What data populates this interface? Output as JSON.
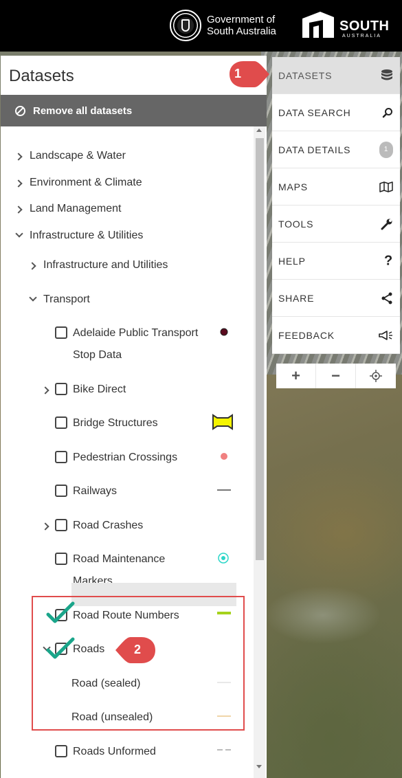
{
  "header": {
    "gov_line1": "Government of",
    "gov_line2": "South Australia",
    "brand": "SOUTH",
    "brand_sub": "AUSTRALIA"
  },
  "panel": {
    "title": "Datasets",
    "remove_all": "Remove all datasets"
  },
  "tree": {
    "categories": [
      "Landscape & Water",
      "Environment & Climate",
      "Land Management",
      "Infrastructure & Utilities"
    ],
    "sub": [
      "Infrastructure and Utilities",
      "Transport"
    ],
    "layers": {
      "adelaide_line1": "Adelaide Public Transport",
      "adelaide_line2": "Stop Data",
      "bike": "Bike Direct",
      "bridge": "Bridge Structures",
      "pedestrian": "Pedestrian Crossings",
      "railways": "Railways",
      "crashes": "Road Crashes",
      "maint_line1": "Road Maintenance",
      "maint_line2": "Markers",
      "route_numbers": "Road Route Numbers",
      "roads": "Roads",
      "sealed": "Road (sealed)",
      "unsealed": "Road (unsealed)",
      "unformed": "Roads Unformed"
    }
  },
  "callouts": {
    "one": "1",
    "two": "2"
  },
  "nav": {
    "items": [
      "DATASETS",
      "DATA SEARCH",
      "DATA DETAILS",
      "MAPS",
      "TOOLS",
      "HELP",
      "SHARE",
      "FEEDBACK"
    ],
    "details_badge": "1",
    "icons": [
      "database-icon",
      "search-icon",
      "badge",
      "map-icon",
      "wrench-icon",
      "question-icon",
      "share-icon",
      "megaphone-icon"
    ]
  },
  "zoom": {
    "in": "+",
    "out": "−"
  },
  "colors": {
    "active_nav": "#e0e0e0",
    "remove_bar": "#666666",
    "callout_red": "#e04c4c",
    "check_teal": "#1aa58a",
    "route_green": "#a5d21c",
    "bridge_yellow": "#f5f500",
    "ped_pink": "#f08080"
  }
}
